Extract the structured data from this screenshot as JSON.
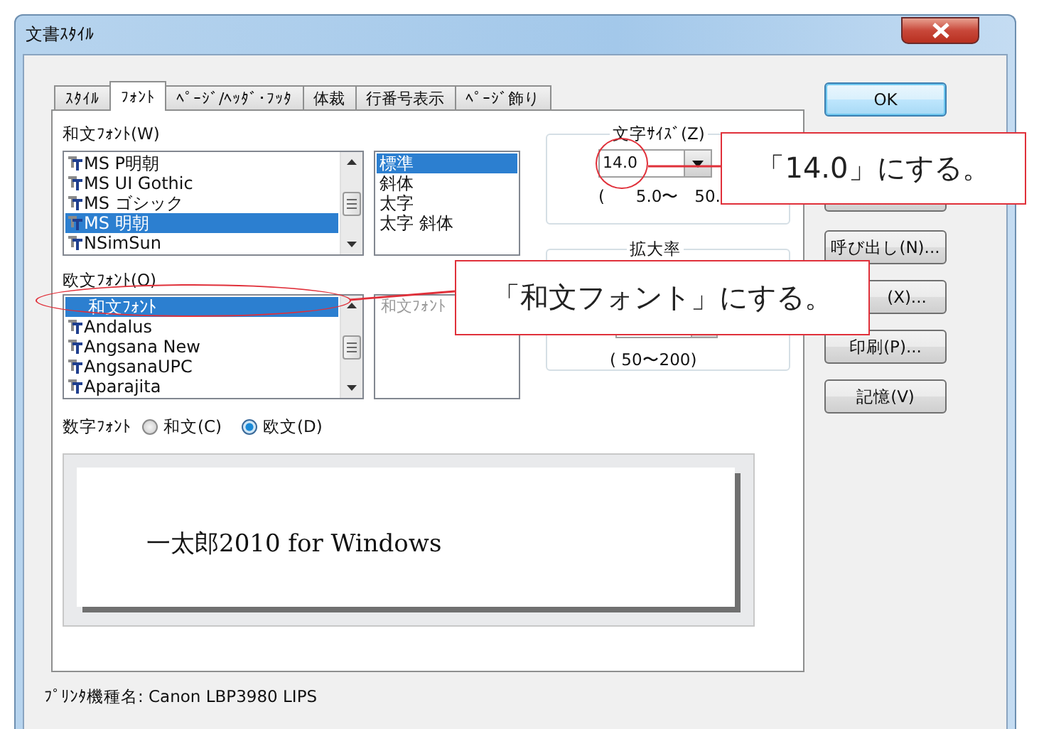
{
  "window": {
    "title": "文書ｽﾀｲﾙ"
  },
  "tabs": [
    {
      "label": "ｽﾀｲﾙ",
      "selected": false
    },
    {
      "label": "ﾌｫﾝﾄ",
      "selected": true
    },
    {
      "label": "ﾍﾟｰｼﾞ/ﾍｯﾀﾞ･ﾌｯﾀ",
      "selected": false
    },
    {
      "label": "体裁",
      "selected": false
    },
    {
      "label": "行番号表示",
      "selected": false
    },
    {
      "label": "ﾍﾟｰｼﾞ飾り",
      "selected": false
    }
  ],
  "japanese_font": {
    "label": "和文ﾌｫﾝﾄ(W)",
    "items": [
      {
        "name": "MS P明朝",
        "kind": "truetype",
        "selected": false
      },
      {
        "name": "MS UI Gothic",
        "kind": "truetype",
        "selected": false
      },
      {
        "name": "MS ゴシック",
        "kind": "truetype",
        "selected": false
      },
      {
        "name": "MS 明朝",
        "kind": "truetype",
        "selected": true
      },
      {
        "name": "NSimSun",
        "kind": "truetype",
        "selected": false
      }
    ]
  },
  "style_list": {
    "items": [
      {
        "label": "標準",
        "selected": true
      },
      {
        "label": "斜体",
        "selected": false
      },
      {
        "label": "太字",
        "selected": false
      },
      {
        "label": "太字 斜体",
        "selected": false
      }
    ]
  },
  "western_font": {
    "label": "欧文ﾌｫﾝﾄ(O)",
    "items": [
      {
        "name": "和文ﾌｫﾝﾄ",
        "kind": "plain",
        "selected": true
      },
      {
        "name": "Andalus",
        "kind": "truetype",
        "selected": false
      },
      {
        "name": "Angsana New",
        "kind": "truetype",
        "selected": false
      },
      {
        "name": "AngsanaUPC",
        "kind": "truetype",
        "selected": false
      },
      {
        "name": "Aparajita",
        "kind": "truetype",
        "selected": false
      }
    ]
  },
  "western_style": {
    "value": "和文ﾌｫﾝﾄ"
  },
  "font_size": {
    "label": "文字ｻｲｽﾞ(Z)",
    "value": "14.0",
    "range": "(      5.0〜   50."
  },
  "scale": {
    "label": "拡大率",
    "range": "( 50〜200)"
  },
  "digit_font": {
    "label": "数字ﾌｫﾝﾄ",
    "options": [
      {
        "label": "和文(C)",
        "selected": false
      },
      {
        "label": "欧文(D)",
        "selected": true
      }
    ]
  },
  "preview": {
    "text": "一太郎2010 for Windows"
  },
  "buttons": [
    {
      "label": "OK",
      "kind": "default"
    },
    {
      "kind": "plain"
    },
    {
      "label": "呼び出し(N)...",
      "kind": "plain"
    },
    {
      "label": "(X)...",
      "kind": "plain"
    },
    {
      "label": "印刷(P)...",
      "kind": "plain"
    },
    {
      "label": "記憶(V)",
      "kind": "plain"
    }
  ],
  "status_bar": {
    "text": "ﾌﾟﾘﾝﾀ機種名: Canon LBP3980 LIPS"
  },
  "callouts": [
    {
      "text": "「14.0」にする。"
    },
    {
      "text": "「和文フォント」にする。"
    }
  ]
}
